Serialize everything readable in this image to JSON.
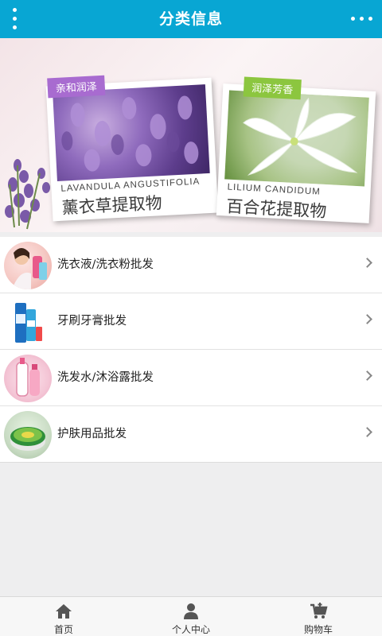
{
  "header": {
    "title": "分类信息",
    "menu_icon": "vertical-dots-icon",
    "more_icon": "horizontal-dots-icon",
    "color": "#08a6d3"
  },
  "banner": {
    "slides_count": 2,
    "cards": [
      {
        "tag": "亲和润泽",
        "latin": "LAVANDULA ANGUSTIFOLIA",
        "name": "薰衣草提取物",
        "tag_color": "#a86bd0"
      },
      {
        "tag": "润泽芳香",
        "latin": "LILIUM CANDIDUM",
        "name": "百合花提取物",
        "tag_color": "#8cc63f"
      }
    ]
  },
  "categories": [
    {
      "label": "洗衣液/洗衣粉批发",
      "icon": "laundry-detergent-icon"
    },
    {
      "label": "牙刷牙膏批发",
      "icon": "toothpaste-icon"
    },
    {
      "label": "洗发水/沐浴露批发",
      "icon": "shampoo-icon"
    },
    {
      "label": "护肤用品批发",
      "icon": "skincare-icon"
    }
  ],
  "tabbar": [
    {
      "label": "首页",
      "icon": "home-icon"
    },
    {
      "label": "个人中心",
      "icon": "user-icon"
    },
    {
      "label": "购物车",
      "icon": "cart-icon"
    }
  ]
}
